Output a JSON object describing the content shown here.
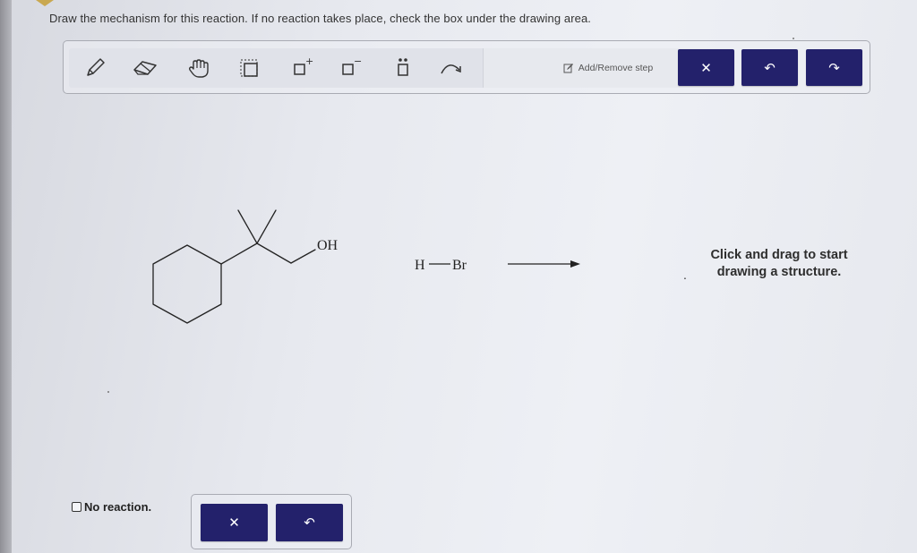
{
  "instructions": "Draw the mechanism for this reaction. If no reaction takes place, check the box under the drawing area.",
  "toolbar": {
    "tools": [
      {
        "name": "pencil-tool",
        "icon": "pencil-icon"
      },
      {
        "name": "eraser-tool",
        "icon": "eraser-icon"
      },
      {
        "name": "hand-tool",
        "icon": "hand-icon"
      },
      {
        "name": "select-tool",
        "icon": "selection-box-icon"
      },
      {
        "name": "positive-charge-tool",
        "icon": "positive-charge-icon",
        "label": "+"
      },
      {
        "name": "negative-charge-tool",
        "icon": "negative-charge-icon",
        "label": "−"
      },
      {
        "name": "lone-pair-tool",
        "icon": "lone-pair-icon"
      },
      {
        "name": "curved-arrow-tool",
        "icon": "curved-arrow-icon"
      }
    ],
    "add_remove_label": "Add/Remove step",
    "clear_label": "✕",
    "undo_label": "↶",
    "redo_label": "↷"
  },
  "reaction": {
    "reactant_group": "OH",
    "reagent_left": "H",
    "reagent_right": "Br"
  },
  "canvas_hint": "Click and drag to start drawing a structure.",
  "no_reaction_label": "No reaction.",
  "bottom_panel": {
    "clear_label": "✕",
    "undo_label": "↶"
  },
  "colors": {
    "button_bg": "#23216b",
    "page_bg": "#e9ebf0",
    "text": "#2b2b2b"
  }
}
